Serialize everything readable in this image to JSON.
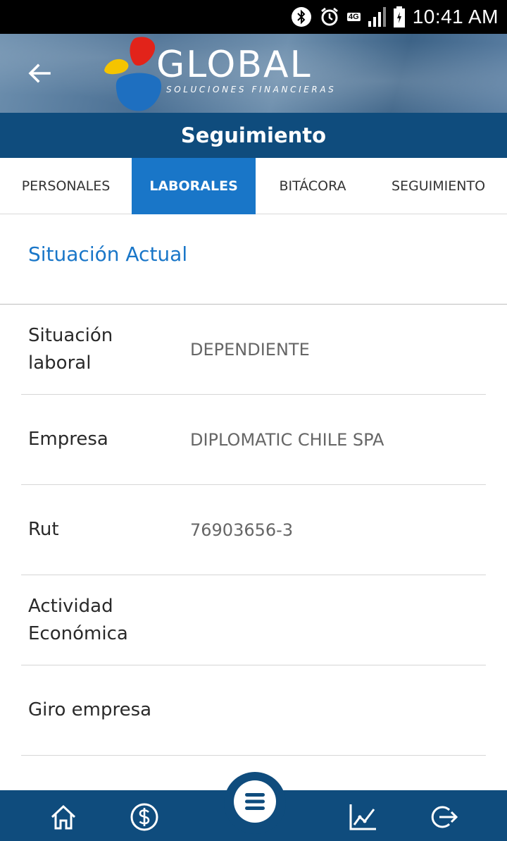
{
  "status_bar": {
    "network": "4G",
    "time": "10:41 AM"
  },
  "header": {
    "brand_name": "GLOBAL",
    "brand_tagline": "SOLUCIONES FINANCIERAS",
    "back_icon": "arrow-left-icon"
  },
  "title": "Seguimiento",
  "tabs": [
    {
      "label": "PERSONALES",
      "active": false
    },
    {
      "label": "LABORALES",
      "active": true
    },
    {
      "label": "BITÁCORA",
      "active": false
    },
    {
      "label": "SEGUIMIENTO",
      "active": false
    }
  ],
  "section": {
    "title": "Situación Actual"
  },
  "rows": [
    {
      "label_line1": "Situación",
      "label_line2": "laboral",
      "value": "DEPENDIENTE"
    },
    {
      "label_line1": "Empresa",
      "label_line2": "",
      "value": "DIPLOMATIC CHILE SPA"
    },
    {
      "label_line1": "Rut",
      "label_line2": "",
      "value": "76903656-3"
    },
    {
      "label_line1": "Actividad",
      "label_line2": "Económica",
      "value": ""
    },
    {
      "label_line1": "Giro empresa",
      "label_line2": "",
      "value": ""
    }
  ],
  "bottom_nav": {
    "items": [
      "home-icon",
      "dollar-icon",
      "menu-icon",
      "chart-icon",
      "logout-icon"
    ]
  },
  "colors": {
    "primary_dark": "#0f4c7d",
    "accent_blue": "#1976c8"
  }
}
